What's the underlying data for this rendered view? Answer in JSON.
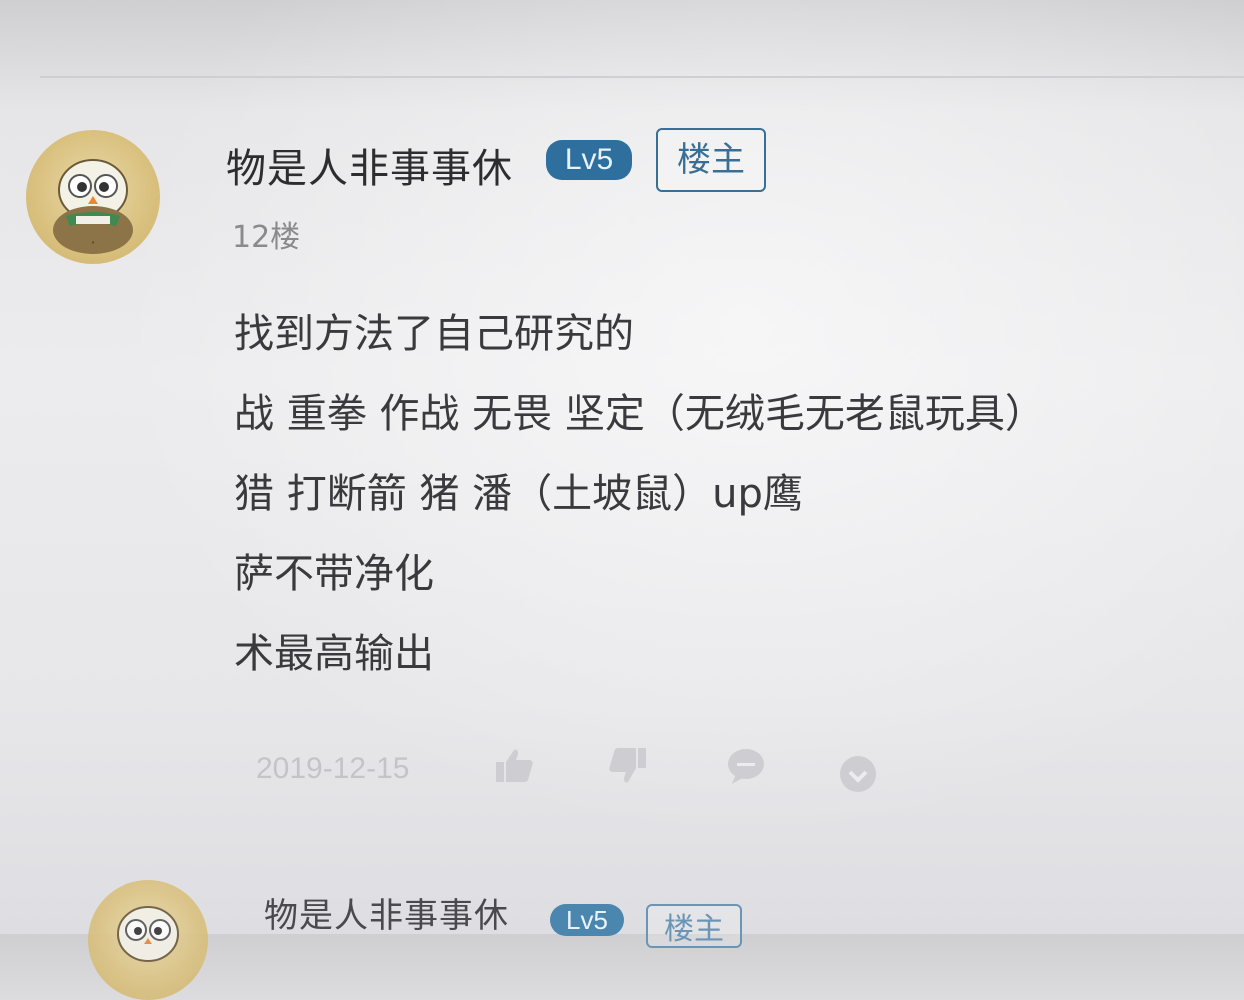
{
  "posts": [
    {
      "username": "物是人非事事休",
      "level": "Lv5",
      "owner_badge": "楼主",
      "floor": "12楼",
      "content_lines": [
        "找到方法了自己研究的",
        "战 重拳 作战  无畏 坚定（无绒毛无老鼠玩具）",
        "猎 打断箭 猪 潘（土坡鼠）up鹰",
        "萨不带净化",
        "术最高输出"
      ],
      "date": "2019-12-15",
      "actions": [
        "thumbs-up-icon",
        "thumbs-down-icon",
        "comment-icon",
        "more-icon"
      ]
    },
    {
      "username": "物是人非事事休",
      "level": "Lv5",
      "owner_badge": "楼主"
    }
  ],
  "colors": {
    "level_badge": "#2f6f9e",
    "owner_badge_border": "#3a6f95",
    "icon_gray": "#cdcdd2"
  }
}
